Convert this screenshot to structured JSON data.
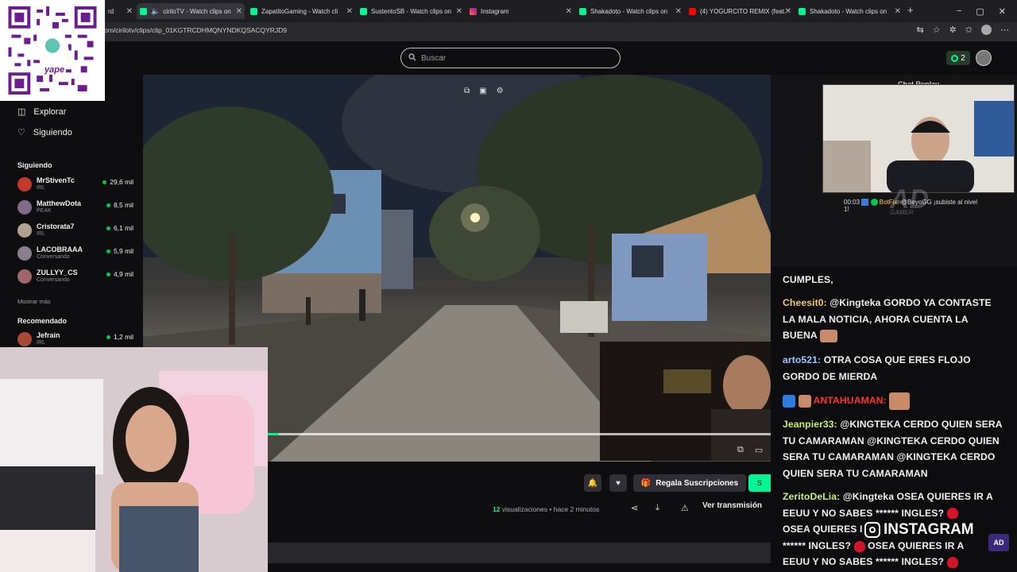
{
  "browser": {
    "tabs": [
      {
        "label": "rd",
        "favicon_color": "#00f593",
        "active": false
      },
      {
        "label": "ciriloTV - Watch clips on",
        "favicon_color": "#00f593",
        "active": true
      },
      {
        "label": "ZapatitoGaming - Watch cli",
        "favicon_color": "#00f593",
        "active": false
      },
      {
        "label": "SustentoSB - Watch clips on",
        "favicon_color": "#00f593",
        "active": false
      },
      {
        "label": "Instagram",
        "favicon_color": "#e1306c",
        "active": false
      },
      {
        "label": "Shakadoto - Watch clips on",
        "favicon_color": "#00f593",
        "active": false
      },
      {
        "label": "(4) YOGURCITO REMIX (feat.",
        "favicon_color": "#ff0000",
        "active": false
      },
      {
        "label": "Shakadoto - Watch clips on",
        "favicon_color": "#00f593",
        "active": false
      }
    ],
    "url": "om/cirilotv/clips/clip_01KGTRCDHMQNYNDKQSACQYRJD9",
    "new_tab": "+",
    "window_controls": {
      "minimize": "−",
      "restore": "▢",
      "close": "✕"
    }
  },
  "header": {
    "search_placeholder": "Buscar",
    "notification_count": "2"
  },
  "qr": {
    "brand": "yape"
  },
  "sidebar": {
    "nav": [
      {
        "label": "Explorar",
        "icon": "compass-icon"
      },
      {
        "label": "Siguiendo",
        "icon": "heart-icon"
      }
    ],
    "following_heading": "Siguiendo",
    "following": [
      {
        "name": "MrStivenTc",
        "category": "IRL",
        "viewers": "29,6 mil",
        "avatar_color": "#c0392b"
      },
      {
        "name": "MatthewDota",
        "category": "PEAK",
        "viewers": "8,5 mil",
        "avatar_color": "#7f6a8a"
      },
      {
        "name": "Cristorata7",
        "category": "IRL",
        "viewers": "6,1 mil",
        "avatar_color": "#b0a090"
      },
      {
        "name": "LACOBRAAA",
        "category": "Conversando",
        "viewers": "5,9 mil",
        "avatar_color": "#8a7d8f"
      },
      {
        "name": "ZULLYY_CS",
        "category": "Conversando",
        "viewers": "4,9 mil",
        "avatar_color": "#a0676a"
      }
    ],
    "show_more": "Mostrar más",
    "recommended_heading": "Recomendado",
    "recommended": [
      {
        "name": "Jefrain",
        "category": "IRL",
        "viewers": "1,2 mil",
        "avatar_color": "#a84a3a"
      }
    ]
  },
  "clip": {
    "progress_fraction": 0.022,
    "gift_label": "Regala Suscripciones",
    "follow_label": "S",
    "views_count": "12",
    "views_text": "visualizaciones • hace 2 minutos",
    "watch_stream_label": "Ver transmisión"
  },
  "chat_overlay": {
    "replay_label": "Chat Replay",
    "timestamp": "00:03",
    "botfix_user": "BotFix:",
    "botfix_msg": "@BeyoGG ¡subiste al nivel",
    "botfix_tail": "1!",
    "logo_text": "AD",
    "logo_sub": "GAMER"
  },
  "chat": {
    "messages": [
      {
        "user": "",
        "text": "CUMPLES,"
      },
      {
        "user": "Cheesit0:",
        "text": "@Kingteka GORDO YA CONTASTE LA MALA NOTICIA, AHORA CUENTA LA BUENA"
      },
      {
        "user": "arto521:",
        "text": "OTRA COSA QUE ERES FLOJO GORDO DE MIERDA"
      },
      {
        "user": "ANTAHUAMAN:",
        "text": ""
      },
      {
        "user": "Jeanpier33:",
        "text": "@KINGTEKA CERDO QUIEN SERA TU CAMARAMAN @KINGTEKA CERDO QUIEN SERA TU CAMARAMAN @KINGTEKA CERDO QUIEN SERA TU CAMARAMAN"
      },
      {
        "user": "ZeritoDeLia:",
        "text": "@Kingteka OSEA QUIERES IR A EEUU Y NO SABES ****** INGLES?"
      },
      {
        "user": "",
        "text": "OSEA QUIERES I"
      },
      {
        "user": "",
        "text": "****** INGLES?"
      },
      {
        "user": "",
        "text": "OSEA QUIERES IR A"
      },
      {
        "user": "",
        "text": "EEUU Y NO SABES ****** INGLES?"
      }
    ]
  },
  "watermark": {
    "instagram": "INSTAGRAM",
    "badge": "AD"
  },
  "colors": {
    "accent": "#00f593",
    "background": "#0e0e10",
    "username": "#f6c768"
  }
}
